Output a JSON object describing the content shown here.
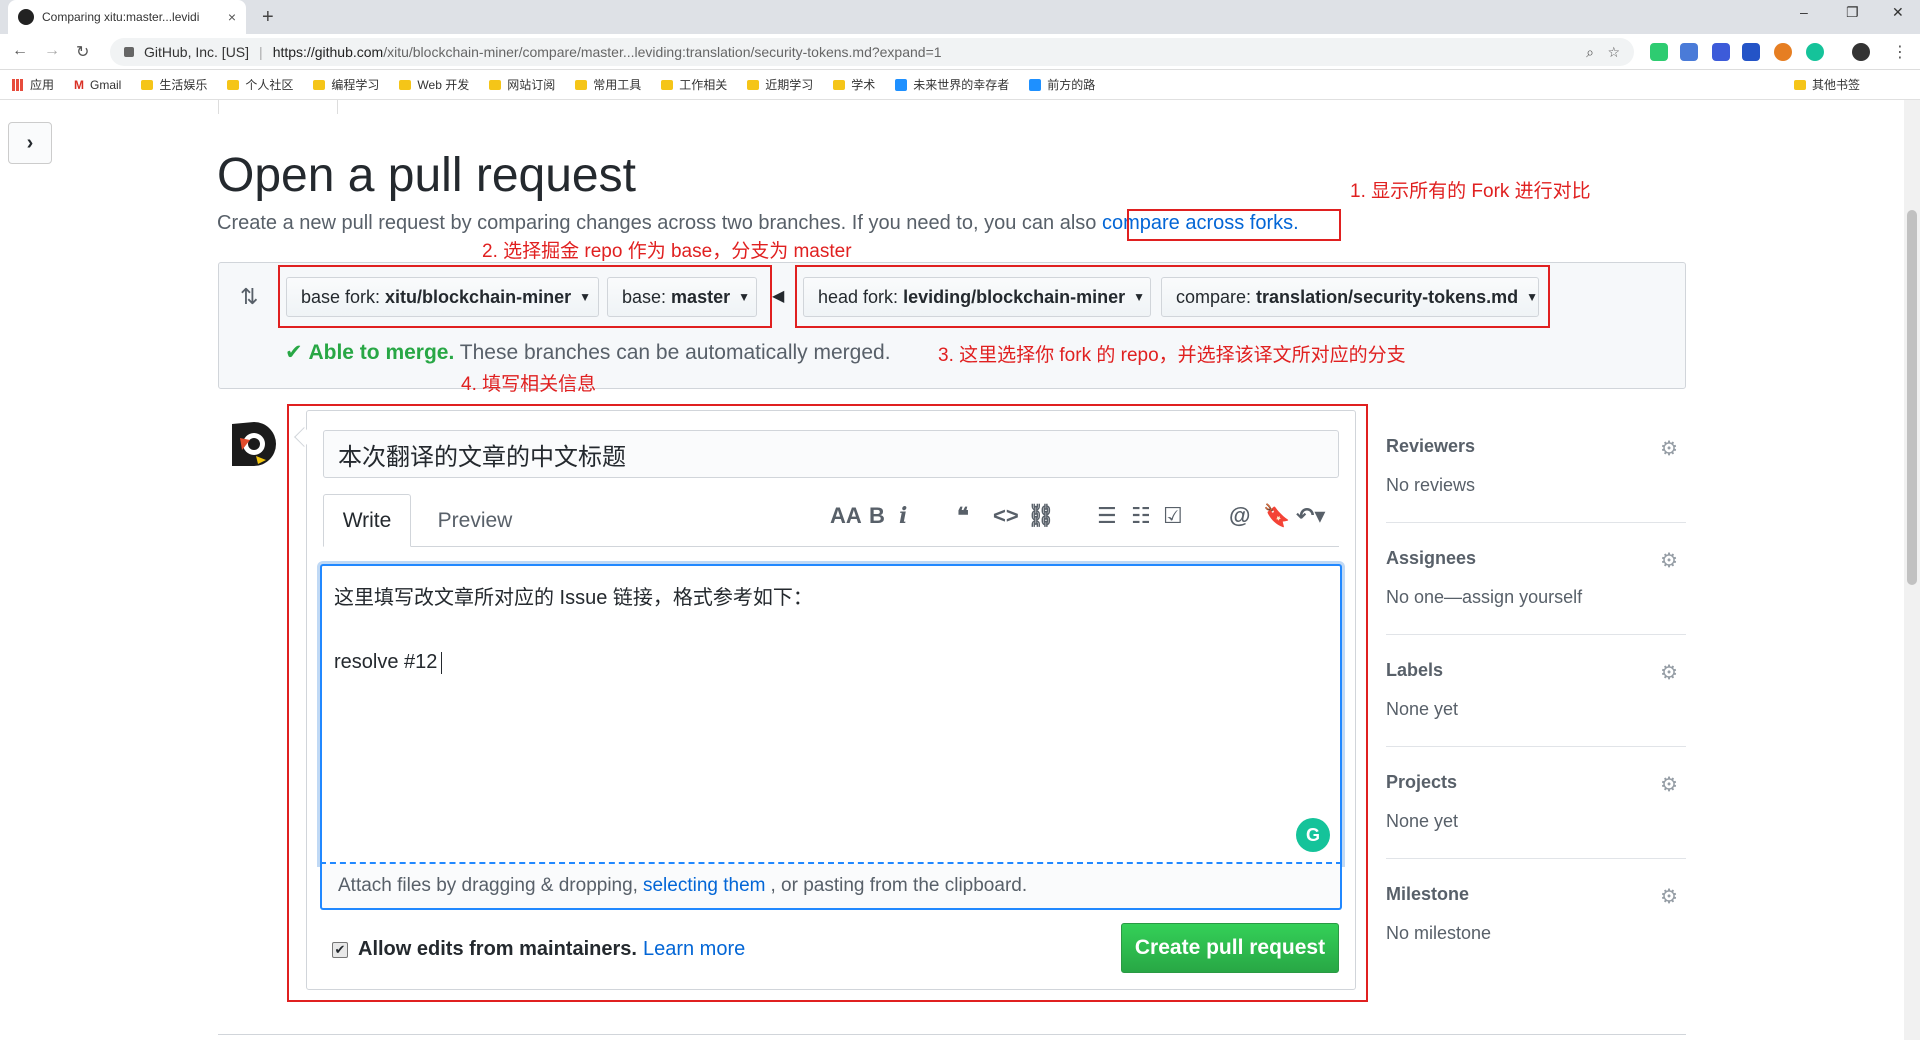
{
  "browser": {
    "tab_title": "Comparing xitu:master...levidi",
    "tab_close": "×",
    "new_tab": "+",
    "minimize": "–",
    "restore": "❐",
    "close": "✕",
    "site_org": "GitHub, Inc. [US]",
    "url_host": "https://github.com",
    "url_path": "/xitu/blockchain-miner/compare/master...leviding:translation/security-tokens.md?expand=1"
  },
  "bookmarks": [
    "应用",
    "Gmail",
    "生活娱乐",
    "个人社区",
    "编程学习",
    "Web 开发",
    "网站订阅",
    "常用工具",
    "工作相关",
    "近期学习",
    "学术",
    "未来世界的幸存者",
    "前方的路"
  ],
  "bookmarks_other": "其他书签",
  "page": {
    "title": "Open a pull request",
    "subtitle": "Create a new pull request by comparing changes across two branches. If you need to, you can also",
    "compare_link": "compare across forks."
  },
  "annotations": {
    "a1": "1. 显示所有的 Fork 进行对比",
    "a2": "2. 选择掘金 repo 作为 base，分支为 master",
    "a3": "3. 这里选择你 fork 的 repo，并选择该译文所对应的分支",
    "a4": "4. 填写相关信息"
  },
  "compare": {
    "base_fork_label": "base fork:",
    "base_fork_value": "xitu/blockchain-miner",
    "base_label": "base:",
    "base_value": "master",
    "head_fork_label": "head fork:",
    "head_fork_value": "leviding/blockchain-miner",
    "compare_label": "compare:",
    "compare_value": "translation/security-tokens.md",
    "able": "Able to merge.",
    "merge_msg": "These branches can be automatically merged."
  },
  "form": {
    "title_value": "本次翻译的文章的中文标题",
    "tab_write": "Write",
    "tab_preview": "Preview",
    "body_line1": "这里填写改文章所对应的 Issue 链接，格式参考如下：",
    "body_line2": "resolve #12",
    "attach_pre": "Attach files by dragging & dropping,",
    "attach_link": "selecting them",
    "attach_post": ", or pasting from the clipboard.",
    "allow_edits": "Allow edits from maintainers.",
    "learn_more": "Learn more",
    "create_button": "Create pull request"
  },
  "sidebar": [
    {
      "heading": "Reviewers",
      "value": "No reviews"
    },
    {
      "heading": "Assignees",
      "value": "No one—assign yourself"
    },
    {
      "heading": "Labels",
      "value": "None yet"
    },
    {
      "heading": "Projects",
      "value": "None yet"
    },
    {
      "heading": "Milestone",
      "value": "No milestone"
    }
  ]
}
